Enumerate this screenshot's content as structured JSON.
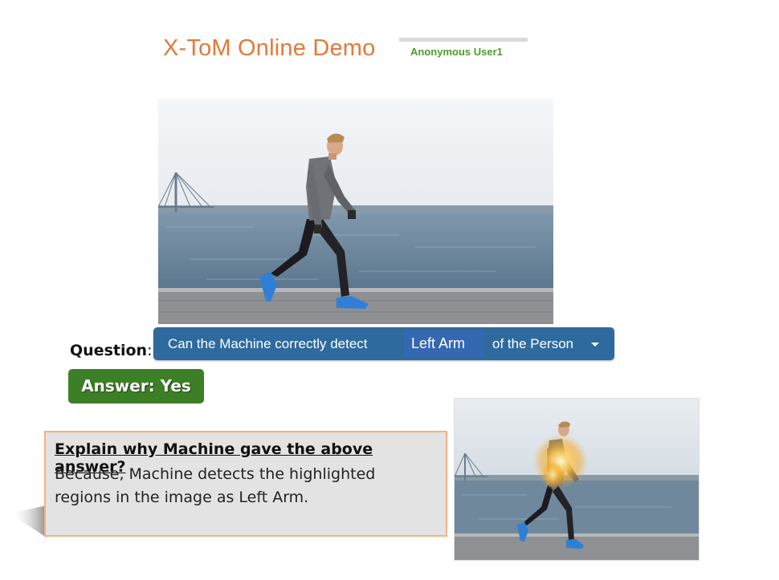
{
  "header": {
    "title": "X-ToM Online Demo",
    "user": "Anonymous User1"
  },
  "question": {
    "label": "Question",
    "colon": ":",
    "prefix": "Can the Machine correctly detect",
    "selected_part": "Left Arm",
    "suffix": "of the Person"
  },
  "answer": {
    "label": "Answer: Yes"
  },
  "explanation": {
    "heading": "Explain why Machine gave the above answer?",
    "body": "Because, Machine detects the highlighted regions in the image as Left Arm."
  },
  "colors": {
    "title": "#e07a3a",
    "user": "#4f9a2e",
    "question_bar": "#2e6a9e",
    "answer_button": "#3d7f27",
    "explain_border": "#f4b183"
  }
}
